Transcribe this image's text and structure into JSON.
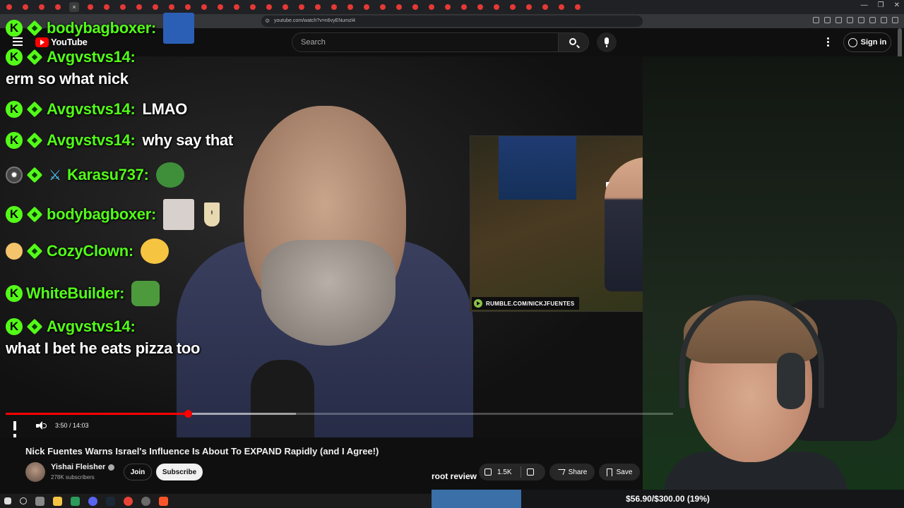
{
  "browser": {
    "url": "youtube.com/watch?v=n6vyENumzl4",
    "tab_count": 36
  },
  "youtube": {
    "logo_text": "YouTube",
    "search_placeholder": "Search",
    "signin_label": "Sign in"
  },
  "chat": [
    {
      "user": "bodybagboxer:",
      "message": "",
      "emote": "avatar"
    },
    {
      "user": "Avgvstvs14:",
      "message": ""
    },
    {
      "message_line": "erm so what nick"
    },
    {
      "user": "Avgvstvs14:",
      "message": "LMAO"
    },
    {
      "user": "Avgvstvs14:",
      "message": "why say that"
    },
    {
      "user": "Karasu737:",
      "message": "",
      "emote": "pepe-scream"
    },
    {
      "user": "bodybagboxer:",
      "message": "",
      "emote": "rat"
    },
    {
      "user": "CozyClown:",
      "message": "",
      "emote": "laugh"
    },
    {
      "user": "WhiteBuilder:",
      "message": "",
      "emote": "pepe-sombrero"
    },
    {
      "user": "Avgvstvs14:",
      "message": ""
    },
    {
      "message_line": "what I bet he eats pizza too"
    }
  ],
  "video": {
    "watermark": "RUMBLE.COM/NICKJFUENTES",
    "current_time": "3:50",
    "duration": "14:03",
    "time_display": "3:50 / 14:03",
    "progress_fraction": 0.273,
    "buffer_fraction": 0.435
  },
  "meta": {
    "title": "Nick Fuentes Warns Israel's Influence Is About To EXPAND Rapidly (and I Agree!)",
    "channel": "Yishai Fleisher",
    "subscribers": "278K subscribers",
    "join_label": "Join",
    "subscribe_label": "Subscribe",
    "likes": "1.5K",
    "share_label": "Share",
    "save_label": "Save"
  },
  "overlay": {
    "root_review": "root review",
    "goal_text": "$56.90/$300.00 (19%)",
    "goal_fraction": 0.19
  },
  "colors": {
    "kick_green": "#53fc18",
    "yt_red": "#ff0000",
    "goal_fill": "#3a6fa8"
  }
}
